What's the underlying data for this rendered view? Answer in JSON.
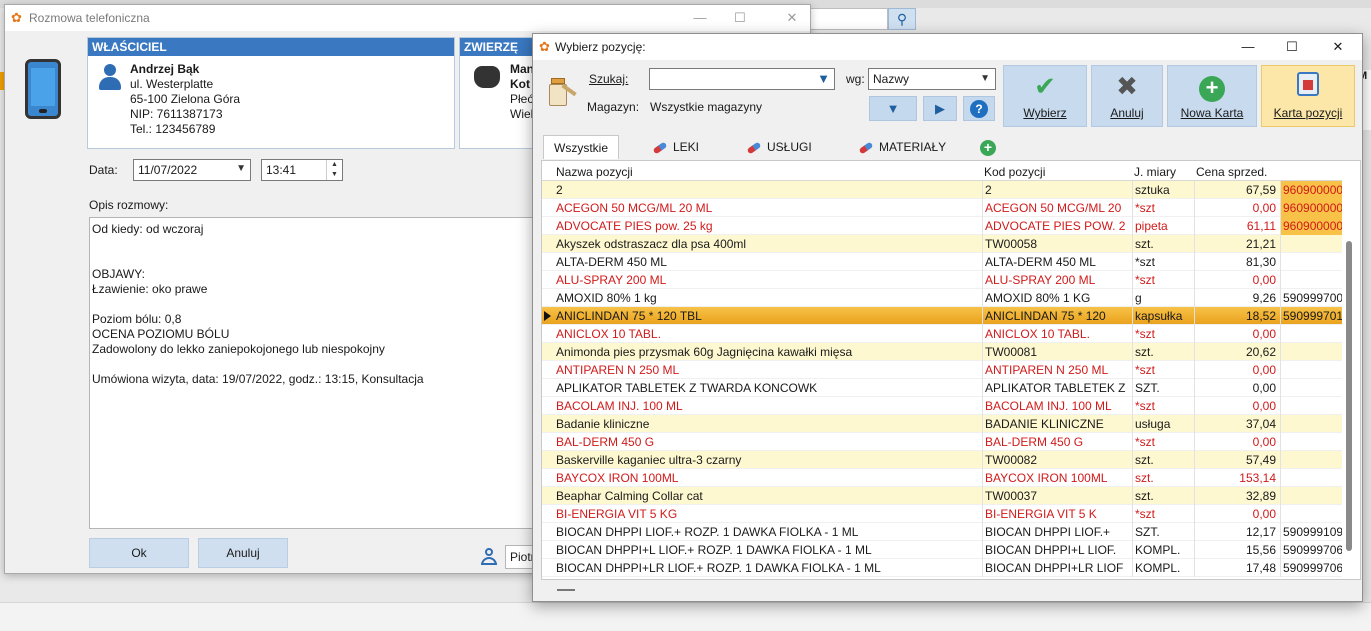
{
  "phone_window": {
    "title": "Rozmowa telefoniczna",
    "owner_header": "WŁAŚCICIEL",
    "owner": {
      "name": "Andrzej Bąk",
      "street": "ul. Westerplatte",
      "city": "65-100  Zielona Góra",
      "nip": "NIP: 7611387173",
      "tel": "Tel.: 123456789"
    },
    "animal_header": "ZWIERZĘ",
    "animal": {
      "line1": "Mani",
      "line2": "Kot r",
      "line3": "Płeć:",
      "line4": "Wiek:"
    },
    "date_label": "Data:",
    "date_value": "11/07/2022",
    "time_value": "13:41",
    "opis_label": "Opis rozmowy:",
    "opis_text": "Od kiedy: od wczoraj\n\n\nOBJAWY:\nŁzawienie: oko prawe\n\nPoziom bólu: 0,8\nOCENA POZIOMU BÓLU\nZadowolony do lekko zaniepokojonego lub niespokojny\n\nUmówiona wizyta, data: 19/07/2022, godz.: 13:15, Konsultacja",
    "ok_label": "Ok",
    "cancel_label": "Anuluj",
    "user_value": "Piotr"
  },
  "select_window": {
    "title": "Wybierz pozycję:",
    "search_label": "Szukaj:",
    "search_value": "",
    "wg_label": "wg:",
    "wg_value": "Nazwy",
    "magazyn_label": "Magazyn:",
    "magazyn_value": "Wszystkie magazyny",
    "buttons": {
      "select": "Wybierz",
      "cancel": "Anuluj",
      "new_card": "Nowa Karta",
      "position_card": "Karta pozycji"
    },
    "tabs": [
      "Wszystkie",
      "LEKI",
      "USŁUGI",
      "MATERIAŁY"
    ],
    "columns": [
      "Nazwa pozycji",
      "Kod pozycji",
      "J. miary",
      "Cena sprzed."
    ],
    "rows": [
      {
        "name": "2",
        "code": "2",
        "unit": "sztuka",
        "price": "67,59",
        "ean": "960900000",
        "style": "alt",
        "ean_hl": true
      },
      {
        "name": "ACEGON  50 MCG/ML 20 ML",
        "code": "ACEGON  50 MCG/ML 20",
        "unit": "*szt",
        "price": "0,00",
        "ean": "960900000",
        "style": "red",
        "ean_hl": true
      },
      {
        "name": "ADVOCATE PIES pow. 25 kg",
        "code": "ADVOCATE PIES POW. 2",
        "unit": "pipeta",
        "price": "61,11",
        "ean": "960900000",
        "style": "red",
        "ean_hl": true
      },
      {
        "name": "Akyszek odstraszacz dla psa 400ml",
        "code": "TW00058",
        "unit": "szt.",
        "price": "21,21",
        "ean": "",
        "style": "alt"
      },
      {
        "name": "ALTA-DERM  450 ML",
        "code": "ALTA-DERM  450 ML",
        "unit": "*szt",
        "price": "81,30",
        "ean": "",
        "style": ""
      },
      {
        "name": "ALU-SPRAY 200 ML",
        "code": "ALU-SPRAY 200 ML",
        "unit": "*szt",
        "price": "0,00",
        "ean": "",
        "style": "red"
      },
      {
        "name": "AMOXID 80% 1 kg",
        "code": "AMOXID 80% 1 KG",
        "unit": "g",
        "price": "9,26",
        "ean": "590999700",
        "style": ""
      },
      {
        "name": "ANICLINDAN 75  * 120 TBL",
        "code": "ANICLINDAN 75  * 120",
        "unit": "kapsułka",
        "price": "18,52",
        "ean": "590999701",
        "style": "sel"
      },
      {
        "name": "ANICLOX 10 TABL.",
        "code": "ANICLOX 10 TABL.",
        "unit": "*szt",
        "price": "0,00",
        "ean": "",
        "style": "red"
      },
      {
        "name": "Animonda pies przysmak 60g Jagnięcina kawałki mięsa",
        "code": "TW00081",
        "unit": "szt.",
        "price": "20,62",
        "ean": "",
        "style": "alt"
      },
      {
        "name": "ANTIPAREN N  250 ML",
        "code": "ANTIPAREN N  250 ML",
        "unit": "*szt",
        "price": "0,00",
        "ean": "",
        "style": "red"
      },
      {
        "name": "APLIKATOR TABLETEK Z TWARDA KONCOWK",
        "code": "APLIKATOR TABLETEK Z",
        "unit": "SZT.",
        "price": "0,00",
        "ean": "",
        "style": ""
      },
      {
        "name": "BACOLAM INJ. 100 ML",
        "code": "BACOLAM INJ. 100 ML",
        "unit": "*szt",
        "price": "0,00",
        "ean": "",
        "style": "red"
      },
      {
        "name": "Badanie kliniczne",
        "code": "BADANIE KLINICZNE",
        "unit": "usługa",
        "price": "37,04",
        "ean": "",
        "style": "alt"
      },
      {
        "name": "BAL-DERM  450 G",
        "code": "BAL-DERM  450 G",
        "unit": "*szt",
        "price": "0,00",
        "ean": "",
        "style": "red"
      },
      {
        "name": "Baskerville kaganiec ultra-3 czarny",
        "code": "TW00082",
        "unit": "szt.",
        "price": "57,49",
        "ean": "",
        "style": "alt"
      },
      {
        "name": "BAYCOX IRON 100ML",
        "code": "BAYCOX IRON 100ML",
        "unit": "szt.",
        "price": "153,14",
        "ean": "",
        "style": "red"
      },
      {
        "name": "Beaphar Calming Collar cat",
        "code": "TW00037",
        "unit": "szt.",
        "price": "32,89",
        "ean": "",
        "style": "alt"
      },
      {
        "name": "BI-ENERGIA VIT   5 KG",
        "code": "BI-ENERGIA VIT   5 K",
        "unit": "*szt",
        "price": "0,00",
        "ean": "",
        "style": "red"
      },
      {
        "name": "BIOCAN DHPPI LIOF.+ ROZP. 1 DAWKA FIOLKA - 1 ML",
        "code": "BIOCAN DHPPI LIOF.+",
        "unit": "SZT.",
        "price": "12,17",
        "ean": "590999109",
        "style": ""
      },
      {
        "name": "BIOCAN DHPPI+L LIOF.+ ROZP. 1 DAWKA FIOLKA - 1 ML",
        "code": "BIOCAN DHPPI+L LIOF.",
        "unit": "KOMPL.",
        "price": "15,56",
        "ean": "590999706",
        "style": ""
      },
      {
        "name": "BIOCAN DHPPI+LR LIOF.+ ROZP. 1 DAWKA FIOLKA - 1 ML",
        "code": "BIOCAN DHPPI+LR LIOF",
        "unit": "KOMPL.",
        "price": "17,48",
        "ean": "590999706",
        "style": ""
      }
    ]
  },
  "background": {
    "right_panel_text": "M"
  }
}
